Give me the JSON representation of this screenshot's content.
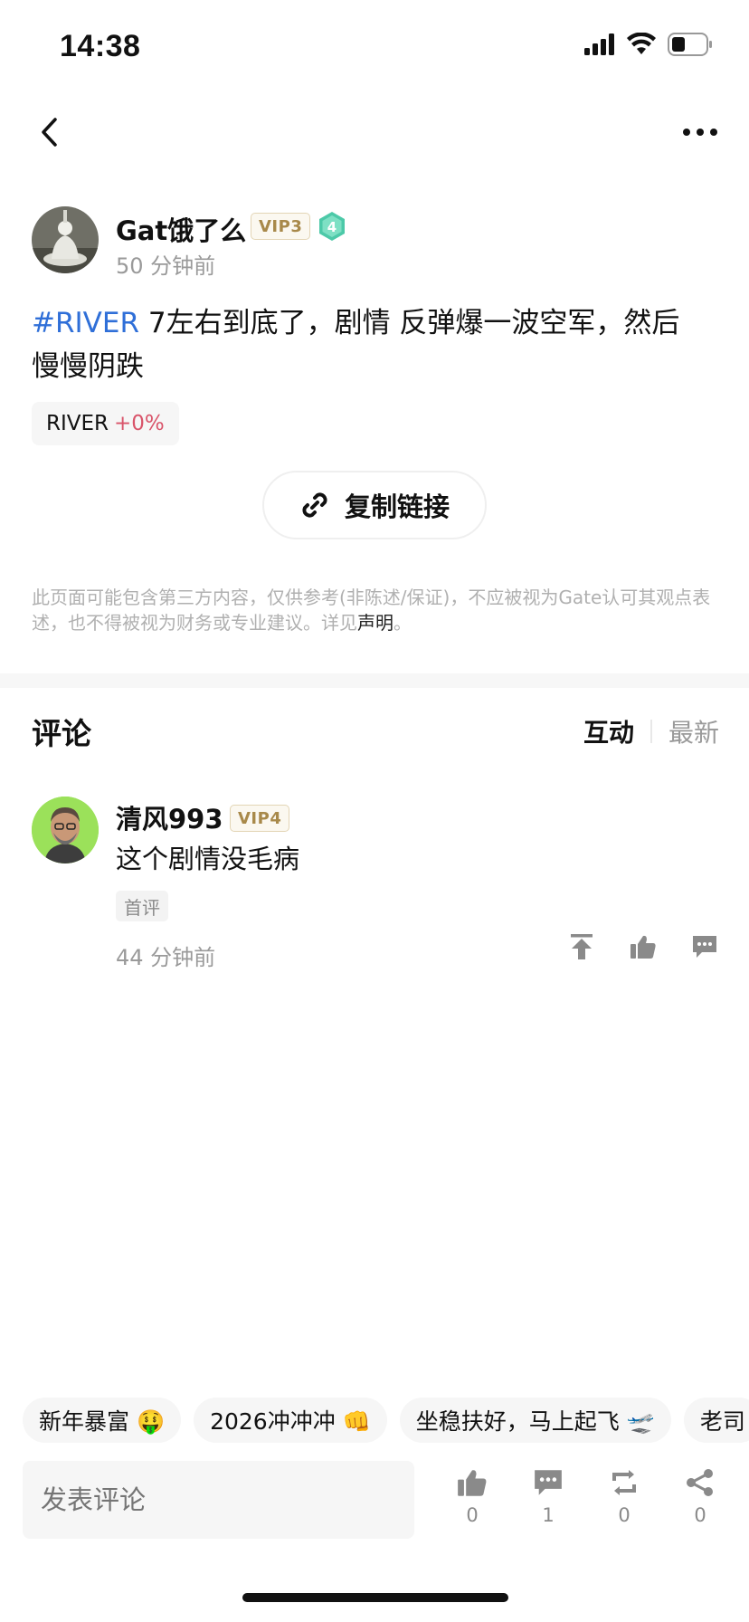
{
  "status_bar": {
    "time": "14:38"
  },
  "author": {
    "name": "Gat饿了么",
    "vip": "VIP3",
    "level": "4",
    "time": "50 分钟前"
  },
  "post": {
    "hashtag": "#RIVER",
    "text_line1": " 7左右到底了，剧情 反弹爆一波空军，然后",
    "text_line2": "慢慢阴跌",
    "coin": {
      "symbol": "RIVER",
      "change": "+0%"
    }
  },
  "copy_link": {
    "label": "复制链接"
  },
  "disclaimer": {
    "text": "此页面可能包含第三方内容，仅供参考(非陈述/保证)，不应被视为Gate认可其观点表述，也不得被视为财务或专业建议。详见",
    "link": "声明",
    "end": "。"
  },
  "comments": {
    "title": "评论",
    "sort_active": "互动",
    "sort_inactive": "最新",
    "items": [
      {
        "name": "清风993",
        "vip": "VIP4",
        "text": "这个剧情没毛病",
        "tag": "首评",
        "time": "44 分钟前"
      }
    ]
  },
  "quick_replies": [
    "新年暴富 🤑",
    "2026冲冲冲 👊",
    "坐稳扶好，马上起飞 🛫",
    "老司"
  ],
  "input": {
    "placeholder": "发表评论"
  },
  "bottom_actions": {
    "like_count": "0",
    "comment_count": "1",
    "repost_count": "0",
    "share_count": "0"
  },
  "colors": {
    "hashtag": "#2f6fd8",
    "price_change": "#d9546a",
    "vip_gold": "#a8894a",
    "level_teal": "#4cc9a8"
  }
}
